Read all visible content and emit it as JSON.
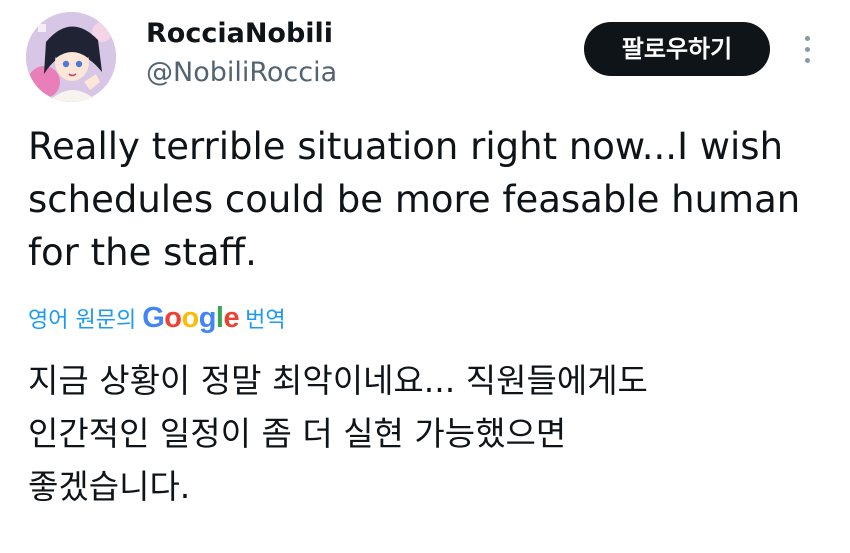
{
  "tweet": {
    "user": {
      "display_name": "RocciaNobili",
      "handle": "@NobiliRoccia",
      "avatar_icon": "anime-character-avatar"
    },
    "follow_button_label": "팔로우하기",
    "more_icon": "vertical-dots-icon",
    "text": "Really terrible situation right now...I wish\nschedules could be more feasable human\nfor the staff.",
    "translation": {
      "prefix_label": "영어 원문의",
      "provider": "Google",
      "suffix_label": "번역",
      "text": "지금 상황이 정말 최악이네요... 직원들에게도\n인간적인 일정이 좀 더 실현 가능했으면\n좋겠습니다."
    }
  }
}
